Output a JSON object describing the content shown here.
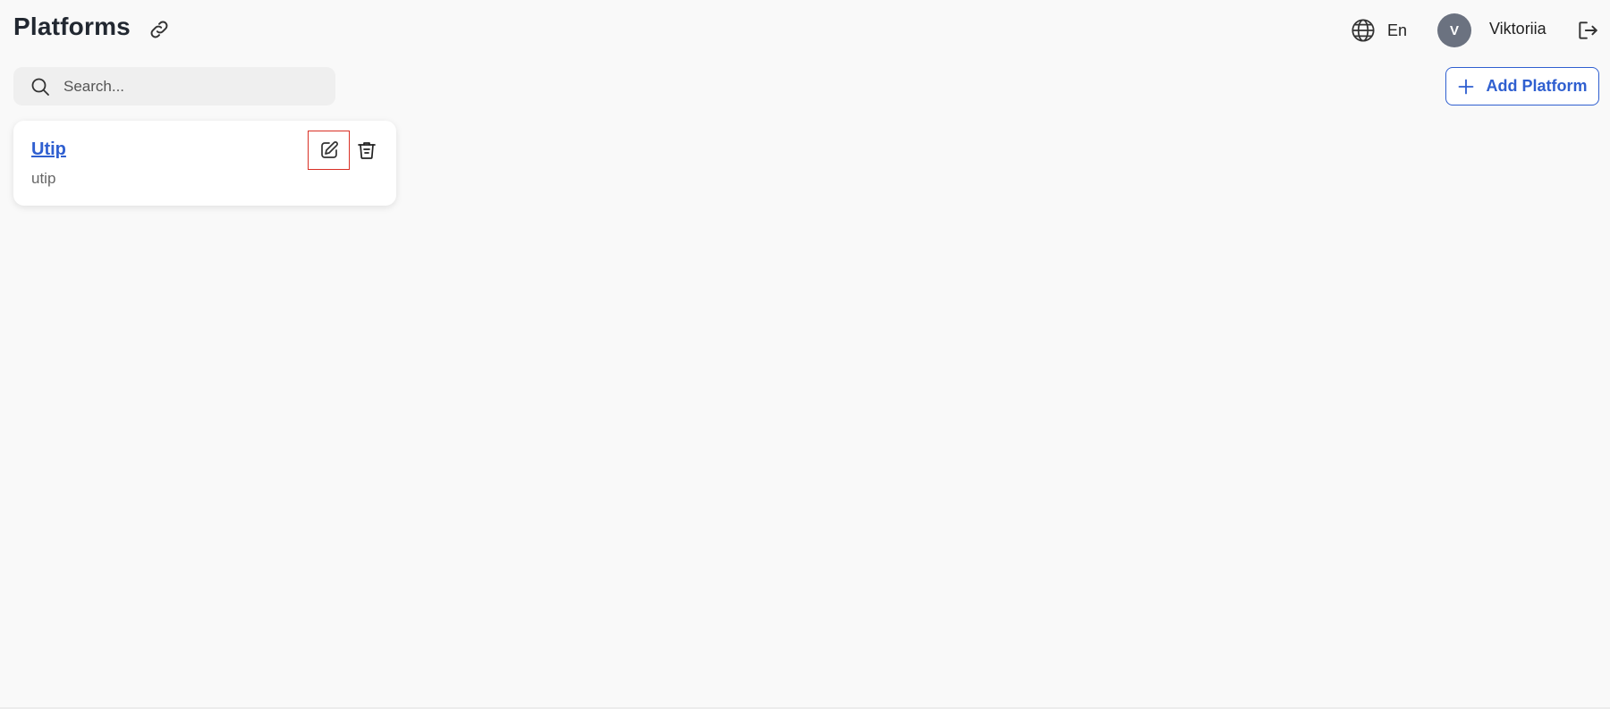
{
  "header": {
    "title": "Platforms",
    "title_icon": "link-icon",
    "language": {
      "icon": "globe-icon",
      "label": "En"
    },
    "user": {
      "avatar_initial": "V",
      "name": "Viktoriia",
      "logout_icon": "logout-icon"
    }
  },
  "toolbar": {
    "search": {
      "icon": "search-icon",
      "placeholder": "Search...",
      "value": ""
    },
    "add_button_label": "Add Platform",
    "add_button_icon": "plus-icon"
  },
  "platforms": [
    {
      "name": "Utip",
      "slug": "utip",
      "edit_icon": "edit-icon",
      "delete_icon": "trash-icon"
    }
  ],
  "colors": {
    "accent": "#2f5fd0",
    "background": "#f9f9f9",
    "avatar": "#6b7280",
    "highlight": "#d93025"
  }
}
